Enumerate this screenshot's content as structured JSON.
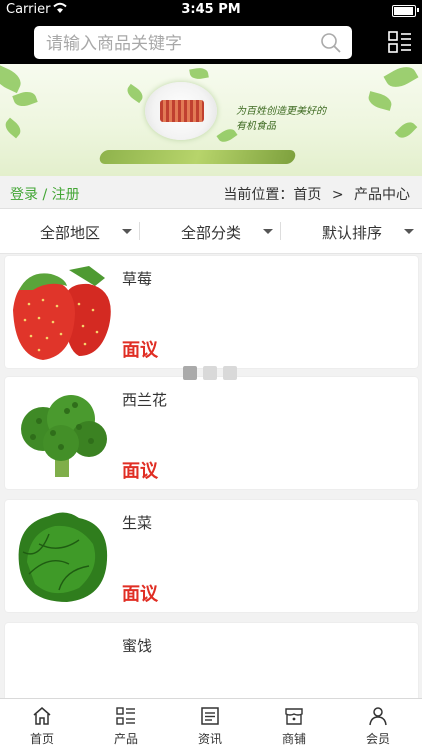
{
  "status_bar": {
    "carrier": "Carrier",
    "time": "3:45 PM"
  },
  "search": {
    "placeholder": "请输入商品关键字"
  },
  "banner": {
    "slogan_line1": "为百姓创造更美好的",
    "slogan_line2": "有机食品"
  },
  "breadcrumb": {
    "login": "登录 / 注册",
    "prefix": "当前位置：",
    "home": "首页",
    "separator": ">",
    "current": "产品中心"
  },
  "filters": [
    {
      "label": "全部地区"
    },
    {
      "label": "全部分类"
    },
    {
      "label": "默认排序"
    }
  ],
  "products": [
    {
      "name": "草莓",
      "price": "面议",
      "image": "strawberry"
    },
    {
      "name": "西兰花",
      "price": "面议",
      "image": "broccoli"
    },
    {
      "name": "生菜",
      "price": "面议",
      "image": "lettuce"
    },
    {
      "name": "蜜饯",
      "price": "",
      "image": ""
    }
  ],
  "tabbar": [
    {
      "label": "首页",
      "icon": "home-icon"
    },
    {
      "label": "产品",
      "icon": "product-icon"
    },
    {
      "label": "资讯",
      "icon": "news-icon"
    },
    {
      "label": "商铺",
      "icon": "shop-icon"
    },
    {
      "label": "会员",
      "icon": "member-icon"
    }
  ],
  "colors": {
    "accent_green": "#43a635",
    "price_red": "#e02e24",
    "header_black": "#000000"
  }
}
